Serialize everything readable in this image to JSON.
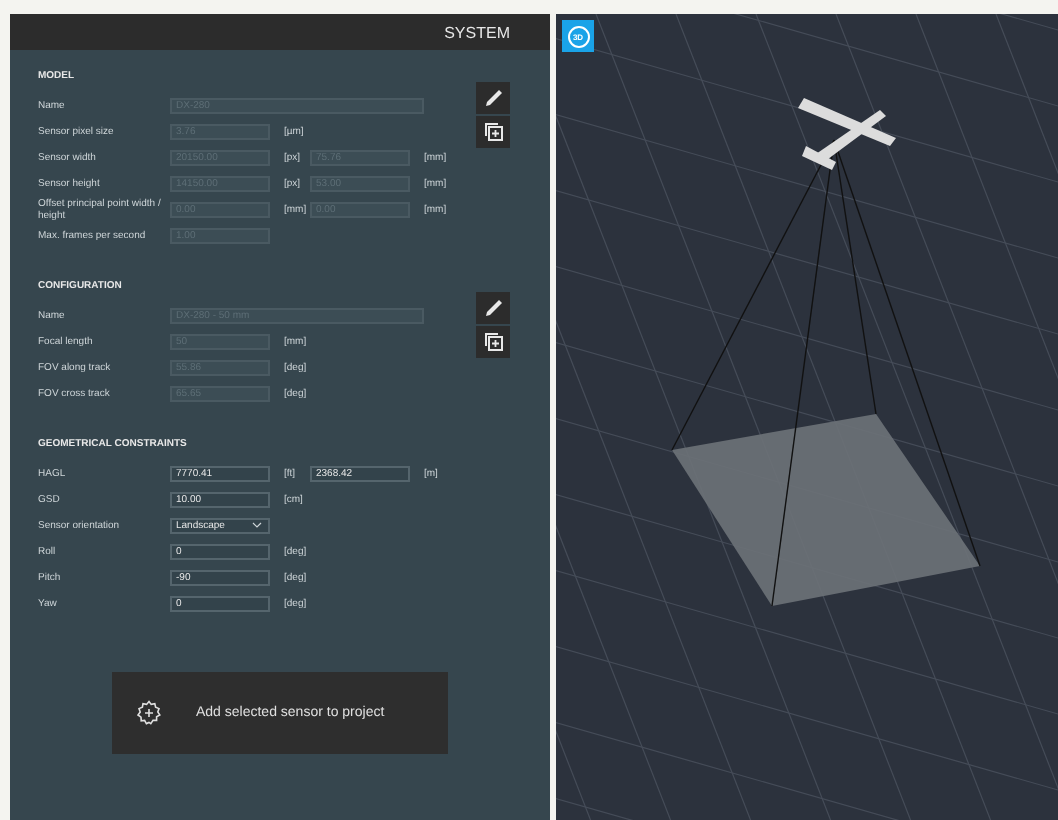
{
  "panel": {
    "title": "SYSTEM"
  },
  "sections": [
    {
      "title": "MODEL",
      "tools": true,
      "rows": [
        {
          "label": "Name",
          "fields": [
            {
              "kind": "wide",
              "value": "DX-280",
              "disabled": true
            }
          ]
        },
        {
          "label": "Sensor pixel size",
          "fields": [
            {
              "kind": "text",
              "value": "3.76",
              "unit": "[µm]",
              "disabled": true
            }
          ]
        },
        {
          "label": "Sensor width",
          "fields": [
            {
              "kind": "text",
              "value": "20150.00",
              "unit": "[px]",
              "disabled": true
            },
            {
              "kind": "text",
              "value": "75.76",
              "unit": "[mm]",
              "disabled": true
            }
          ]
        },
        {
          "label": "Sensor height",
          "fields": [
            {
              "kind": "text",
              "value": "14150.00",
              "unit": "[px]",
              "disabled": true
            },
            {
              "kind": "text",
              "value": "53.00",
              "unit": "[mm]",
              "disabled": true
            }
          ]
        },
        {
          "label": "Offset principal point width / height",
          "fields": [
            {
              "kind": "text",
              "value": "0.00",
              "unit": "[mm]",
              "disabled": true
            },
            {
              "kind": "text",
              "value": "0.00",
              "unit": "[mm]",
              "disabled": true
            }
          ]
        },
        {
          "label": "Max. frames per second",
          "fields": [
            {
              "kind": "text",
              "value": "1.00",
              "disabled": true
            }
          ]
        }
      ]
    },
    {
      "title": "CONFIGURATION",
      "tools": true,
      "rows": [
        {
          "label": "Name",
          "fields": [
            {
              "kind": "wide",
              "value": "DX-280 - 50 mm",
              "disabled": true
            }
          ]
        },
        {
          "label": "Focal length",
          "fields": [
            {
              "kind": "text",
              "value": "50",
              "unit": "[mm]",
              "disabled": true
            }
          ]
        },
        {
          "label": "FOV along track",
          "fields": [
            {
              "kind": "text",
              "value": "55.86",
              "unit": "[deg]",
              "disabled": true
            }
          ]
        },
        {
          "label": "FOV cross track",
          "fields": [
            {
              "kind": "text",
              "value": "65.65",
              "unit": "[deg]",
              "disabled": true
            }
          ]
        }
      ]
    },
    {
      "title": "GEOMETRICAL CONSTRAINTS",
      "tools": false,
      "rows": [
        {
          "label": "HAGL",
          "fields": [
            {
              "kind": "text",
              "value": "7770.41",
              "unit": "[ft]",
              "disabled": false
            },
            {
              "kind": "text",
              "value": "2368.42",
              "unit": "[m]",
              "disabled": false
            }
          ]
        },
        {
          "label": "GSD",
          "fields": [
            {
              "kind": "text",
              "value": "10.00",
              "unit": "[cm]",
              "disabled": false
            }
          ]
        },
        {
          "label": "Sensor orientation",
          "fields": [
            {
              "kind": "dropdown",
              "value": "Landscape",
              "disabled": false
            }
          ]
        },
        {
          "label": "Roll",
          "fields": [
            {
              "kind": "text",
              "value": "0",
              "unit": "[deg]",
              "disabled": false
            }
          ]
        },
        {
          "label": "Pitch",
          "fields": [
            {
              "kind": "text",
              "value": "-90",
              "unit": "[deg]",
              "disabled": false
            }
          ]
        },
        {
          "label": "Yaw",
          "fields": [
            {
              "kind": "text",
              "value": "0",
              "unit": "[deg]",
              "disabled": false
            }
          ]
        }
      ]
    }
  ],
  "add_button": {
    "label": "Add selected sensor to project"
  },
  "view": {
    "badge": "3D"
  }
}
